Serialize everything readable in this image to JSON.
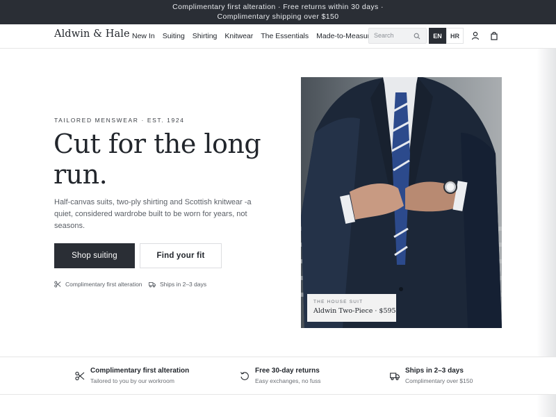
{
  "announcement": "Complimentary first alteration · Free returns within 30 days · Complimentary shipping over $150",
  "header": {
    "logo": "Aldwin & Hale",
    "nav": [
      "New In",
      "Suiting",
      "Shirting",
      "Knitwear",
      "The Essentials",
      "Made-to-Measure"
    ],
    "search_placeholder": "Search",
    "languages": [
      "EN",
      "HR"
    ],
    "active_language": "EN"
  },
  "hero": {
    "eyebrow": "TAILORED MENSWEAR · EST. 1924",
    "headline": "Cut for the long run.",
    "lede": "Half-canvas suits, two-ply shirting and Scottish knitwear -a quiet, considered wardrobe built to be worn for years, not seasons.",
    "primary_cta": "Shop suiting",
    "secondary_cta": "Find your fit",
    "perks": [
      "Complimentary first alteration",
      "Ships in 2–3 days"
    ],
    "image_caption": {
      "overline": "THE HOUSE SUIT",
      "product": "Aldwin Two-Piece · $595"
    }
  },
  "features": [
    {
      "title": "Complimentary first alteration",
      "subtitle": "Tailored to you by our workroom",
      "icon": "scissors-icon"
    },
    {
      "title": "Free 30-day returns",
      "subtitle": "Easy exchanges, no fuss",
      "icon": "return-icon"
    },
    {
      "title": "Ships in 2–3 days",
      "subtitle": "Complimentary over $150",
      "icon": "truck-icon"
    }
  ],
  "colors": {
    "dark": "#2a2e35",
    "text": "#22262c",
    "muted": "#5a5f66",
    "suit_navy": "#1c2738",
    "tie_blue": "#2c4a8c"
  }
}
